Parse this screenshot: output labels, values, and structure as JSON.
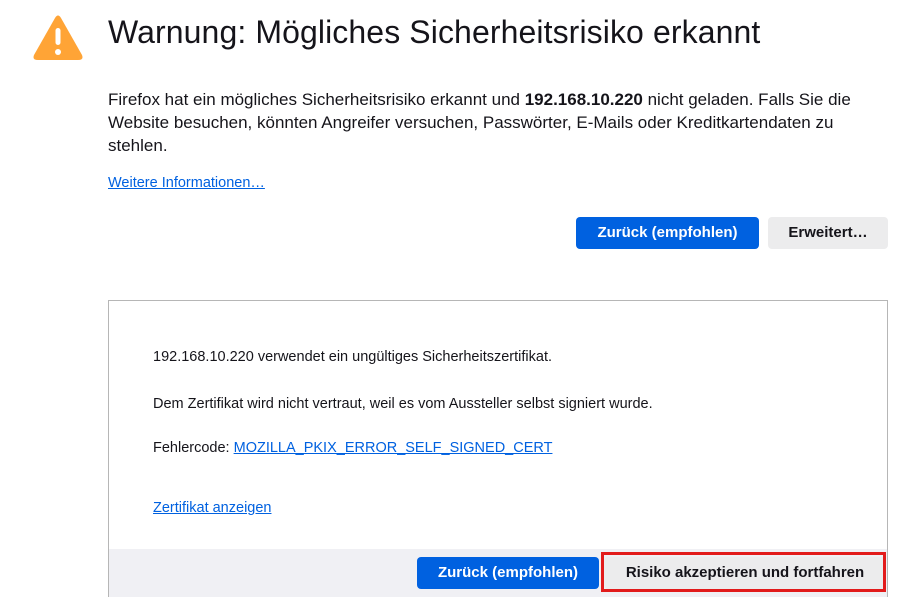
{
  "header": {
    "title": "Warnung: Mögliches Sicherheitsrisiko erkannt",
    "icon": "warning-icon",
    "icon_color": "#ffa436"
  },
  "description": {
    "part1": "Firefox hat ein mögliches Sicherheitsrisiko erkannt und ",
    "host": "192.168.10.220",
    "part2": " nicht geladen. Falls Sie die Website besuchen, könnten Angreifer versuchen, Passwörter, E-Mails oder Kreditkartendaten zu stehlen."
  },
  "learn_more_label": "Weitere Informationen…",
  "buttons": {
    "back_label": "Zurück (empfohlen)",
    "advanced_label": "Erweitert…"
  },
  "advanced": {
    "line1": "192.168.10.220 verwendet ein ungültiges Sicherheitszertifikat.",
    "line2": "Dem Zertifikat wird nicht vertraut, weil es vom Aussteller selbst signiert wurde.",
    "error_code_prefix": "Fehlercode: ",
    "error_code": "MOZILLA_PKIX_ERROR_SELF_SIGNED_CERT",
    "view_cert_label": "Zertifikat anzeigen",
    "back_label": "Zurück (empfohlen)",
    "accept_label": "Risiko akzeptieren und fortfahren"
  },
  "colors": {
    "accent": "#0061e0",
    "highlight": "#e21b1b"
  }
}
